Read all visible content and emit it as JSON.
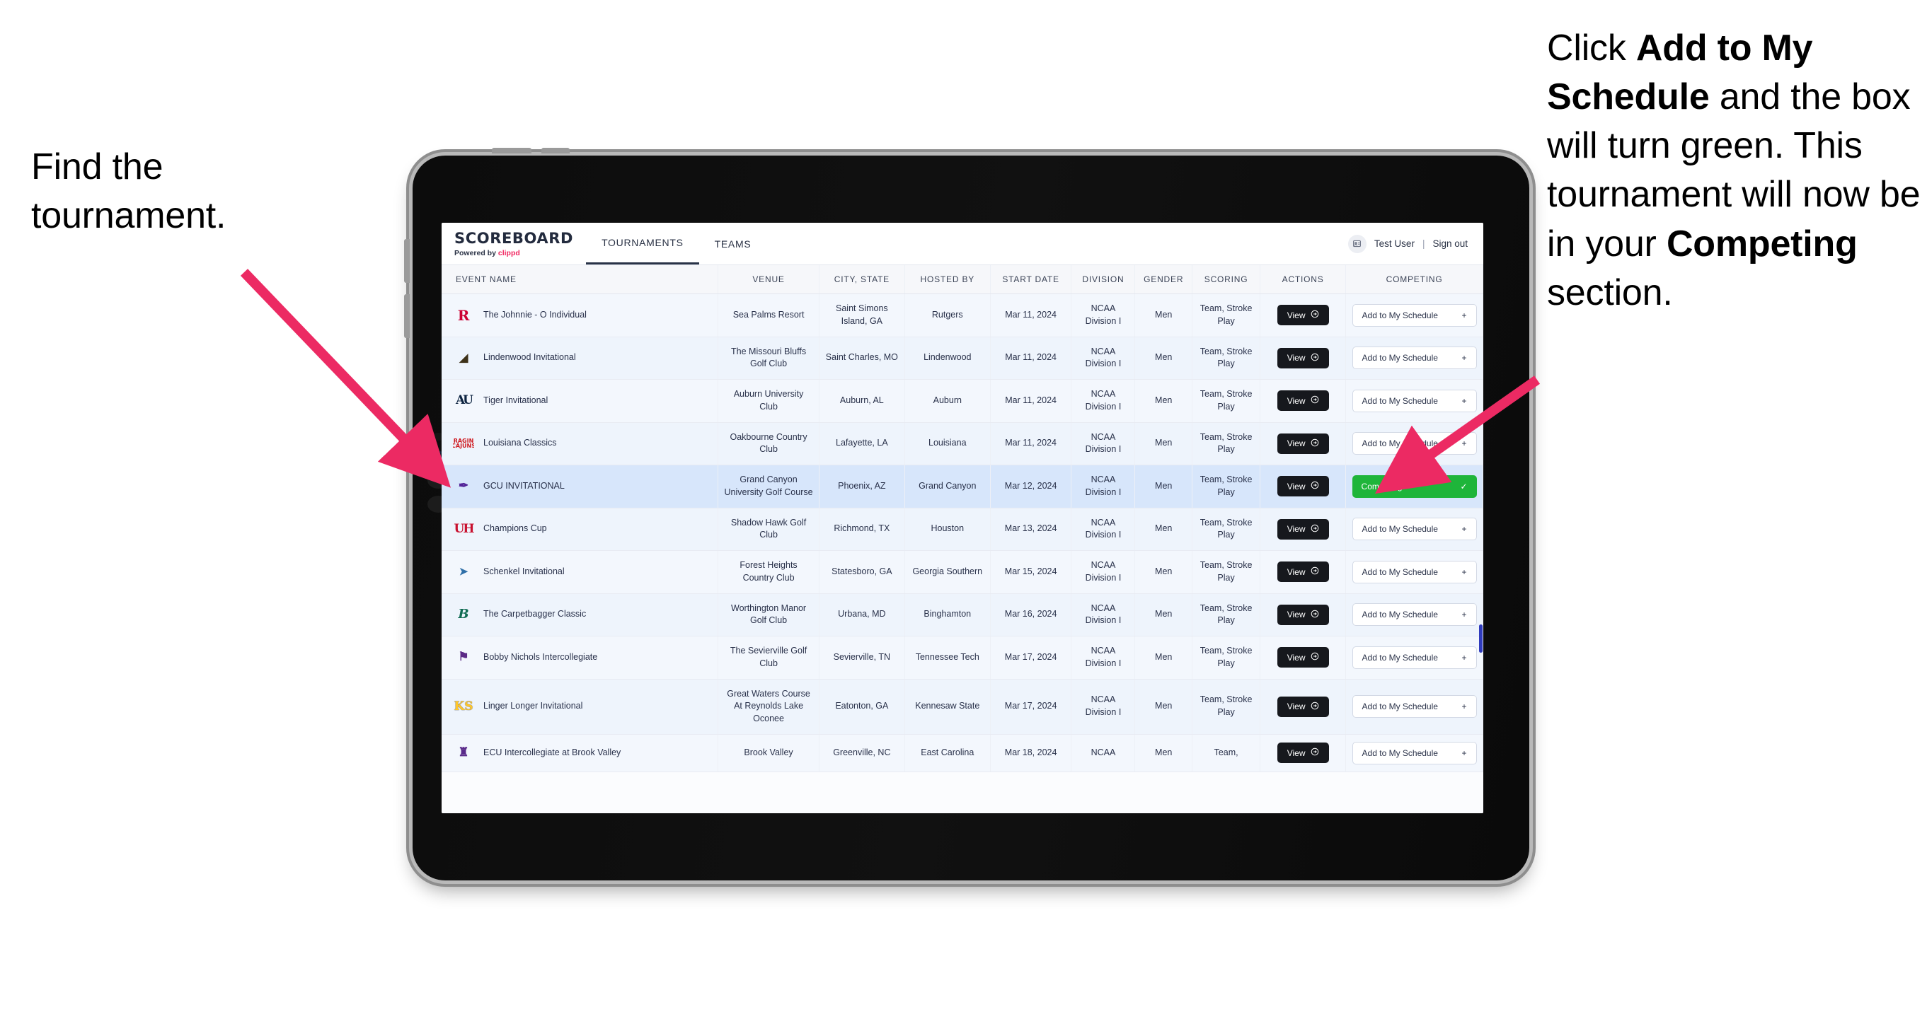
{
  "annotations": {
    "left": {
      "line1": "Find the",
      "line2": "tournament."
    },
    "right": {
      "pre": "Click ",
      "bold1": "Add to My Schedule",
      "mid": " and the box will turn green. This tournament will now be in your ",
      "bold2": "Competing",
      "post": " section."
    }
  },
  "arrow_color": "#EC2A63",
  "app": {
    "logo": {
      "word": "SCOREBOARD",
      "powered_prefix": "Powered by ",
      "brand": "clippd"
    },
    "tabs": [
      {
        "label": "TOURNAMENTS",
        "active": true
      },
      {
        "label": "TEAMS",
        "active": false
      }
    ],
    "user": {
      "icon": "user-card-icon",
      "name": "Test User",
      "divider": "|",
      "signout": "Sign out"
    },
    "table": {
      "columns": [
        "EVENT NAME",
        "VENUE",
        "CITY, STATE",
        "HOSTED BY",
        "START DATE",
        "DIVISION",
        "GENDER",
        "SCORING",
        "ACTIONS",
        "COMPETING"
      ],
      "view_label": "View",
      "add_label": "Add to My Schedule",
      "add_icon": "plus-icon",
      "competing_label": "Competing",
      "competing_icon": "check-icon",
      "competing_color": "#1EB53A",
      "rows": [
        {
          "logo": "rutgers",
          "logo_text": "R",
          "event": "The Johnnie - O Individual",
          "venue": "Sea Palms Resort",
          "city": "Saint Simons Island, GA",
          "host": "Rutgers",
          "date": "Mar 11, 2024",
          "division": "NCAA Division I",
          "gender": "Men",
          "scoring": "Team, Stroke Play",
          "competing": false
        },
        {
          "logo": "lindenwood",
          "logo_text": "◢",
          "event": "Lindenwood Invitational",
          "venue": "The Missouri Bluffs Golf Club",
          "city": "Saint Charles, MO",
          "host": "Lindenwood",
          "date": "Mar 11, 2024",
          "division": "NCAA Division I",
          "gender": "Men",
          "scoring": "Team, Stroke Play",
          "competing": false
        },
        {
          "logo": "auburn",
          "logo_text": "AU",
          "event": "Tiger Invitational",
          "venue": "Auburn University Club",
          "city": "Auburn, AL",
          "host": "Auburn",
          "date": "Mar 11, 2024",
          "division": "NCAA Division I",
          "gender": "Men",
          "scoring": "Team, Stroke Play",
          "competing": false
        },
        {
          "logo": "louisiana",
          "logo_text": "RAGIN CAJUNS",
          "event": "Louisiana Classics",
          "venue": "Oakbourne Country Club",
          "city": "Lafayette, LA",
          "host": "Louisiana",
          "date": "Mar 11, 2024",
          "division": "NCAA Division I",
          "gender": "Men",
          "scoring": "Team, Stroke Play",
          "competing": false
        },
        {
          "logo": "gcu",
          "logo_text": "✒",
          "event": "GCU INVITATIONAL",
          "venue": "Grand Canyon University Golf Course",
          "city": "Phoenix, AZ",
          "host": "Grand Canyon",
          "date": "Mar 12, 2024",
          "division": "NCAA Division I",
          "gender": "Men",
          "scoring": "Team, Stroke Play",
          "competing": true,
          "selected": true
        },
        {
          "logo": "houston",
          "logo_text": "UH",
          "event": "Champions Cup",
          "venue": "Shadow Hawk Golf Club",
          "city": "Richmond, TX",
          "host": "Houston",
          "date": "Mar 13, 2024",
          "division": "NCAA Division I",
          "gender": "Men",
          "scoring": "Team, Stroke Play",
          "competing": false
        },
        {
          "logo": "gasouth",
          "logo_text": "➤",
          "event": "Schenkel Invitational",
          "venue": "Forest Heights Country Club",
          "city": "Statesboro, GA",
          "host": "Georgia Southern",
          "date": "Mar 15, 2024",
          "division": "NCAA Division I",
          "gender": "Men",
          "scoring": "Team, Stroke Play",
          "competing": false
        },
        {
          "logo": "bing",
          "logo_text": "B",
          "event": "The Carpetbagger Classic",
          "venue": "Worthington Manor Golf Club",
          "city": "Urbana, MD",
          "host": "Binghamton",
          "date": "Mar 16, 2024",
          "division": "NCAA Division I",
          "gender": "Men",
          "scoring": "Team, Stroke Play",
          "competing": false
        },
        {
          "logo": "tntech",
          "logo_text": "⚑",
          "event": "Bobby Nichols Intercollegiate",
          "venue": "The Sevierville Golf Club",
          "city": "Sevierville, TN",
          "host": "Tennessee Tech",
          "date": "Mar 17, 2024",
          "division": "NCAA Division I",
          "gender": "Men",
          "scoring": "Team, Stroke Play",
          "competing": false
        },
        {
          "logo": "kennesaw",
          "logo_text": "KS",
          "event": "Linger Longer Invitational",
          "venue": "Great Waters Course At Reynolds Lake Oconee",
          "city": "Eatonton, GA",
          "host": "Kennesaw State",
          "date": "Mar 17, 2024",
          "division": "NCAA Division I",
          "gender": "Men",
          "scoring": "Team, Stroke Play",
          "competing": false
        },
        {
          "logo": "ecu",
          "logo_text": "♜",
          "event": "ECU Intercollegiate at Brook Valley",
          "venue": "Brook Valley",
          "city": "Greenville, NC",
          "host": "East Carolina",
          "date": "Mar 18, 2024",
          "division": "NCAA",
          "gender": "Men",
          "scoring": "Team,",
          "competing": false,
          "cut": true
        }
      ]
    }
  }
}
